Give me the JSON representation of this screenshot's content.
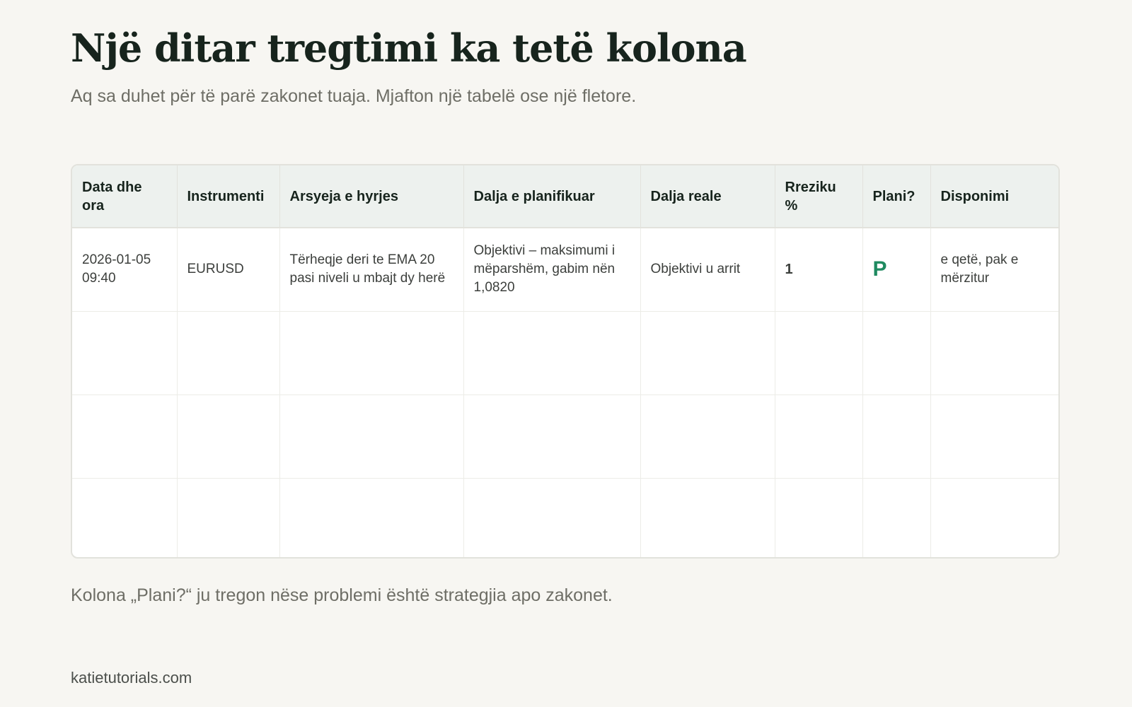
{
  "title": "Një ditar tregtimi ka tetë kolona",
  "subtitle": "Aq sa duhet për të parë zakonet tuaja. Mjafton një tabelë ose një fletore.",
  "table": {
    "headers": [
      "Data dhe ora",
      "Instrumenti",
      "Arsyeja e hyrjes",
      "Dalja e planifikuar",
      "Dalja reale",
      "Rreziku %",
      "Plani?",
      "Disponimi"
    ],
    "rows": [
      [
        "2026-01-05 09:40",
        "EURUSD",
        "Tërheqje deri te EMA 20 pasi niveli u mbajt dy herë",
        "Objektivi – maksimumi i mëparshëm, gabim nën 1,0820",
        "Objektivi u arrit",
        "1",
        "P",
        "e qetë, pak e mërzitur"
      ],
      [
        "",
        "",
        "",
        "",
        "",
        "",
        "",
        ""
      ],
      [
        "",
        "",
        "",
        "",
        "",
        "",
        "",
        ""
      ],
      [
        "",
        "",
        "",
        "",
        "",
        "",
        "",
        ""
      ]
    ]
  },
  "note": "Kolona „Plani?“ ju tregon nëse problemi është strategjia apo zakonet.",
  "footer": "katietutorials.com",
  "colors": {
    "background": "#f7f6f2",
    "header_bg": "#edf1ee",
    "plan_mark": "#1f8a60",
    "title": "#17241d"
  }
}
